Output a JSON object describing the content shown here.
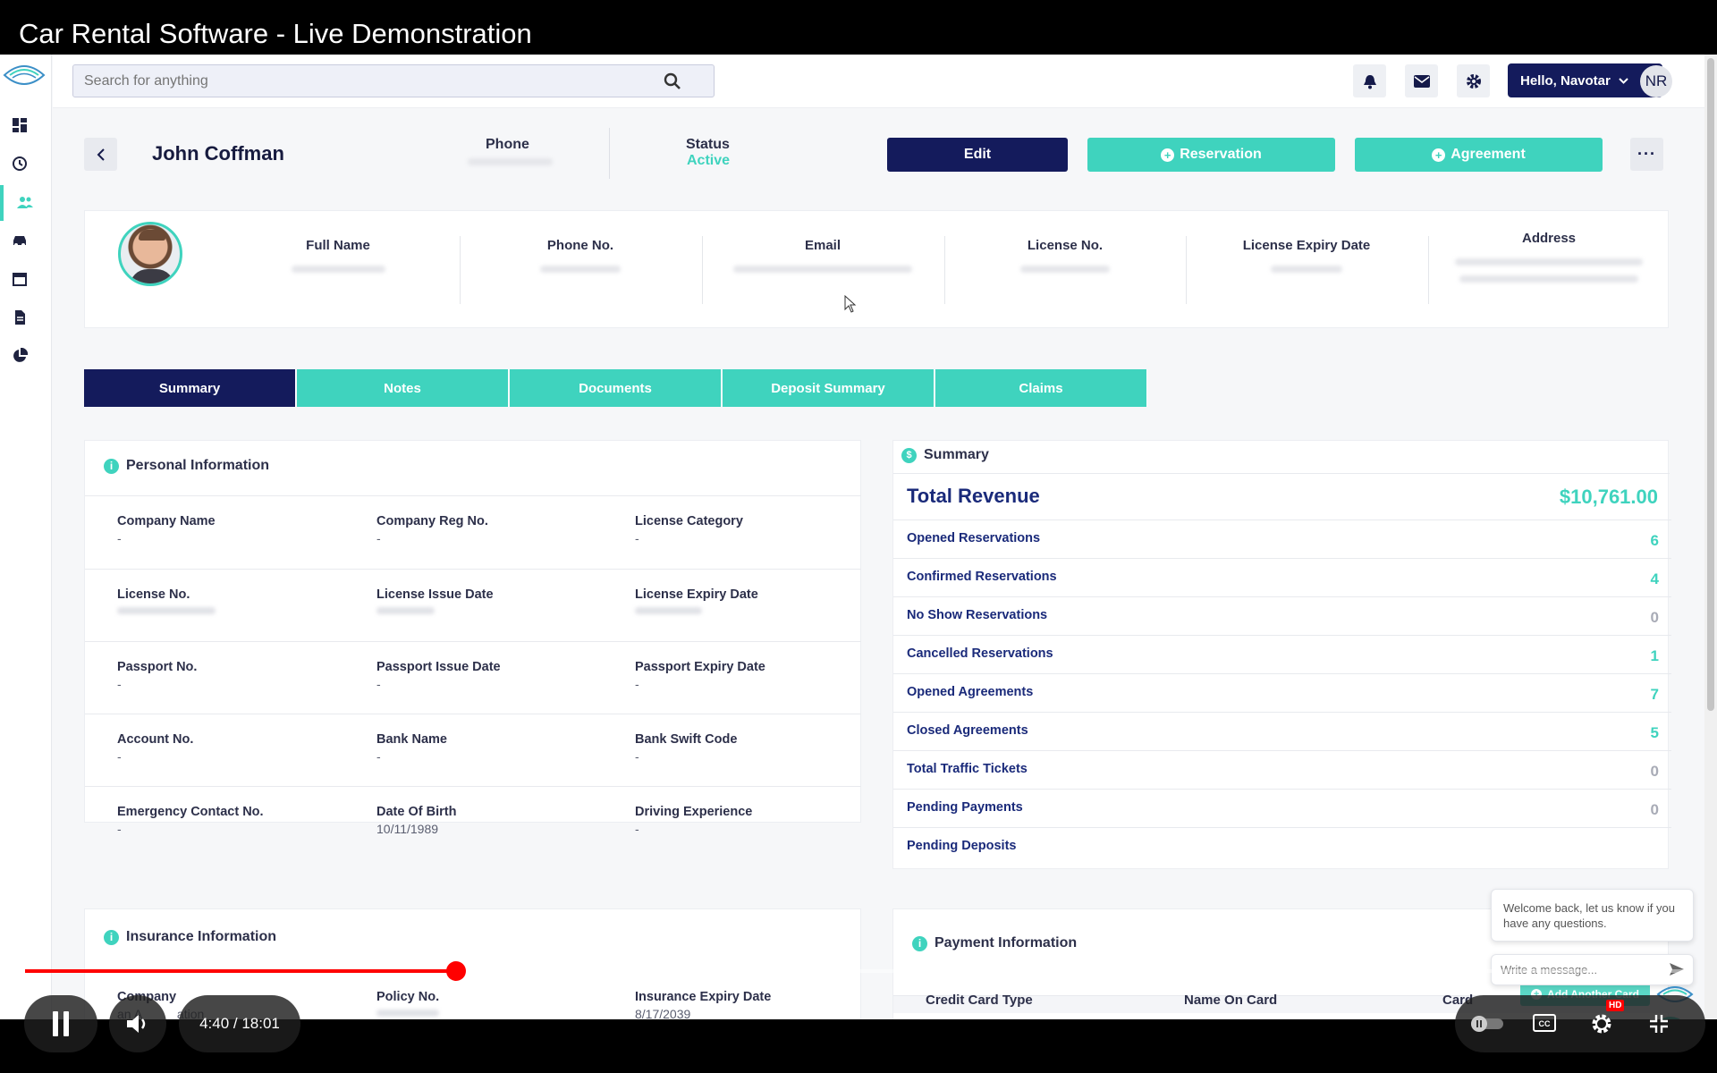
{
  "video": {
    "title": "Car Rental Software - Live Demonstration",
    "time": "4:40 / 18:01",
    "progress": 0.259,
    "buffered": 0.33,
    "quality_badge": "HD"
  },
  "search": {
    "placeholder": "Search for anything"
  },
  "user": {
    "greeting": "Hello, Navotar",
    "initials": "NR"
  },
  "customer": {
    "name": "John Coffman",
    "phone_label": "Phone",
    "status_label": "Status",
    "status_value": "Active"
  },
  "actions": {
    "edit": "Edit",
    "reservation": "Reservation",
    "agreement": "Agreement",
    "more": "···"
  },
  "profile_fields": [
    {
      "label": "Full Name"
    },
    {
      "label": "Phone No."
    },
    {
      "label": "Email"
    },
    {
      "label": "License No."
    },
    {
      "label": "License Expiry Date"
    },
    {
      "label": "Address"
    }
  ],
  "tabs": [
    "Summary",
    "Notes",
    "Documents",
    "Deposit Summary",
    "Claims"
  ],
  "personal_info": {
    "title": "Personal Information",
    "rows": [
      [
        {
          "k": "Company Name",
          "v": "-"
        },
        {
          "k": "Company Reg No.",
          "v": "-"
        },
        {
          "k": "License Category",
          "v": "-"
        }
      ],
      [
        {
          "k": "License No.",
          "v": ""
        },
        {
          "k": "License Issue Date",
          "v": ""
        },
        {
          "k": "License Expiry Date",
          "v": ""
        }
      ],
      [
        {
          "k": "Passport No.",
          "v": "-"
        },
        {
          "k": "Passport Issue Date",
          "v": "-"
        },
        {
          "k": "Passport Expiry Date",
          "v": "-"
        }
      ],
      [
        {
          "k": "Account No.",
          "v": "-"
        },
        {
          "k": "Bank Name",
          "v": "-"
        },
        {
          "k": "Bank Swift Code",
          "v": "-"
        }
      ],
      [
        {
          "k": "Emergency Contact No.",
          "v": "-"
        },
        {
          "k": "Date Of Birth",
          "v": "10/11/1989"
        },
        {
          "k": "Driving Experience",
          "v": "-"
        }
      ]
    ]
  },
  "summary": {
    "title": "Summary",
    "total_label": "Total Revenue",
    "total_value": "$10,761.00",
    "rows": [
      {
        "k": "Opened Reservations",
        "v": "6"
      },
      {
        "k": "Confirmed Reservations",
        "v": "4"
      },
      {
        "k": "No Show Reservations",
        "v": "0"
      },
      {
        "k": "Cancelled Reservations",
        "v": "1"
      },
      {
        "k": "Opened Agreements",
        "v": "7"
      },
      {
        "k": "Closed Agreements",
        "v": "5"
      },
      {
        "k": "Total Traffic Tickets",
        "v": "0"
      },
      {
        "k": "Pending Payments",
        "v": "0"
      },
      {
        "k": "Pending Deposits",
        "v": ""
      }
    ]
  },
  "insurance": {
    "title": "Insurance Information",
    "cols": [
      {
        "k": "Company",
        "v": "an A          ation"
      },
      {
        "k": "Policy No.",
        "v": ""
      },
      {
        "k": "Insurance Expiry Date",
        "v": "8/17/2039"
      }
    ]
  },
  "payment": {
    "title": "Payment Information",
    "add_card": "Add Another Card",
    "cols": [
      "Credit Card Type",
      "Name On Card",
      "Card"
    ]
  },
  "chat": {
    "welcome": "Welcome back, let us know if you have any questions.",
    "placeholder": "Write a message..."
  },
  "colors": {
    "navy": "#141b5c",
    "teal": "#3fd3be",
    "progress": "#ff0000"
  }
}
